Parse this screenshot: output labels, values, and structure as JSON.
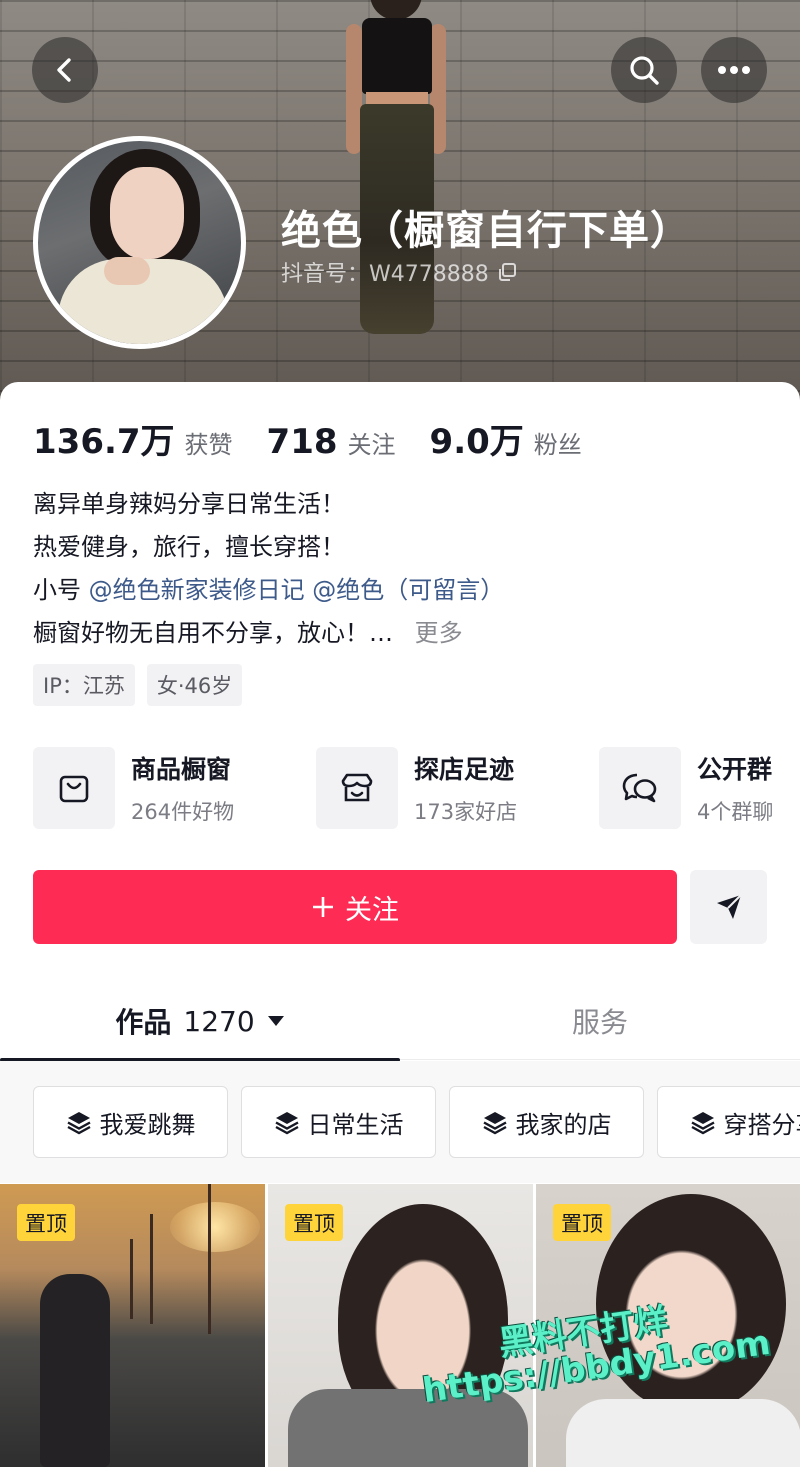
{
  "profile": {
    "display_name": "绝色（橱窗自行下单）",
    "douyin_id": "抖音号：W4778888"
  },
  "stats": [
    {
      "value": "136.7万",
      "label": "获赞"
    },
    {
      "value": "718",
      "label": "关注"
    },
    {
      "value": "9.0万",
      "label": "粉丝"
    }
  ],
  "bio": {
    "line1": "离异单身辣妈分享日常生活！",
    "line2": "热爱健身，旅行，擅长穿搭！",
    "line3_prefix": "小号",
    "mention1": "@绝色新家装修日记",
    "mention2": "@绝色（可留言）",
    "line4": "橱窗好物无自用不分享，放心！…",
    "more": "更多"
  },
  "tags": [
    "IP：江苏",
    "女·46岁"
  ],
  "features": [
    {
      "title": "商品橱窗",
      "sub": "264件好物",
      "icon": "shopping-bag-icon"
    },
    {
      "title": "探店足迹",
      "sub": "173家好店",
      "icon": "store-icon"
    },
    {
      "title": "公开群",
      "sub": "4个群聊",
      "icon": "group-chat-icon"
    }
  ],
  "follow_button": {
    "label": "关注"
  },
  "tabs": {
    "works_label": "作品",
    "works_count": "1270",
    "services_label": "服务"
  },
  "collections": [
    "我爱跳舞",
    "日常生活",
    "我家的店",
    "穿搭分享"
  ],
  "videos": [
    {
      "badge": "置顶"
    },
    {
      "badge": "置顶"
    },
    {
      "badge": "置顶"
    }
  ],
  "watermark": {
    "line1": "黑料不打烊",
    "line2": "https://bbdy1.com"
  },
  "colors": {
    "accent": "#fe2c55",
    "mention": "#3d5a8a",
    "pin_badge": "#ffd43b"
  }
}
